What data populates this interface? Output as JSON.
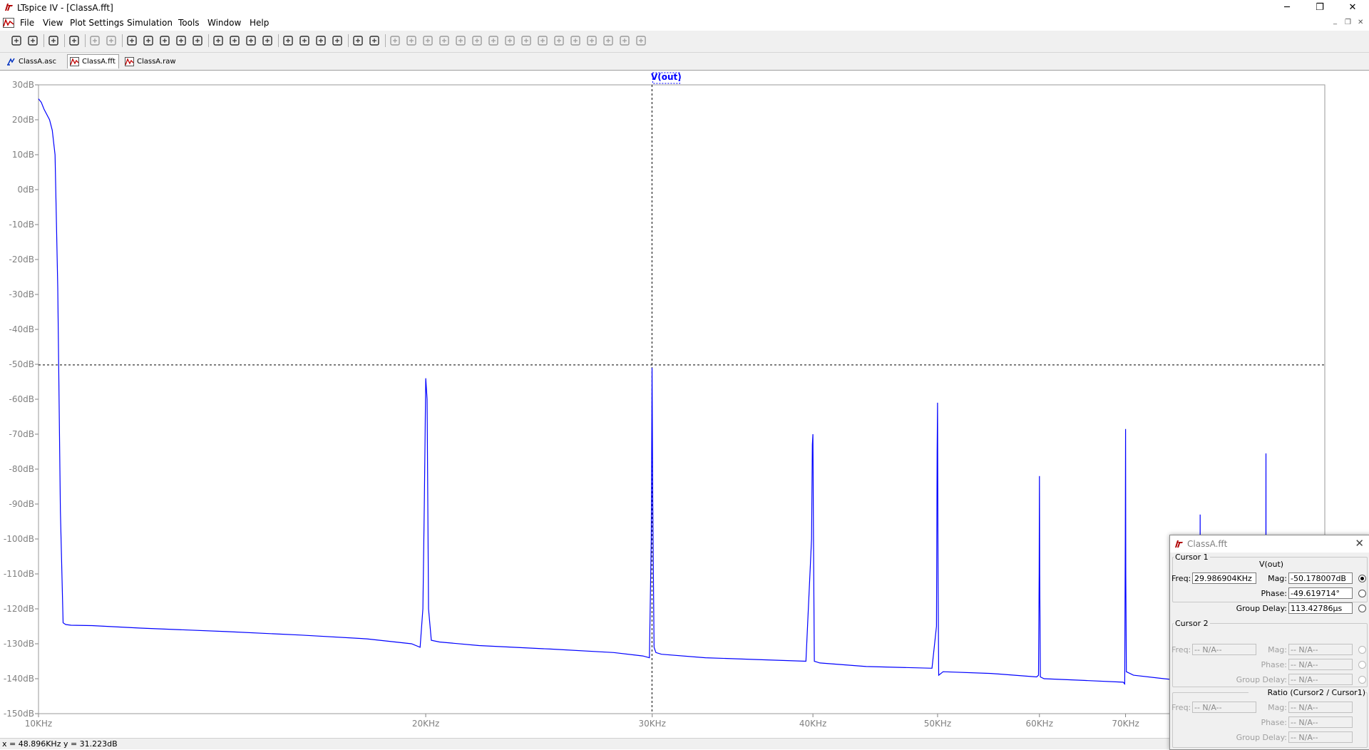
{
  "window": {
    "title": "LTspice IV - [ClassA.fft]",
    "minimize": "─",
    "restore": "❐",
    "close": "✕",
    "mdi_min": "_",
    "mdi_restore": "❐",
    "mdi_close": "✕"
  },
  "menu": {
    "items": [
      "File",
      "View",
      "Plot Settings",
      "Simulation",
      "Tools",
      "Window",
      "Help"
    ]
  },
  "toolbar": {
    "icons": [
      "new-schematic-icon",
      "open-icon",
      "save-icon",
      "control-panel-icon",
      "run-icon",
      "halt-icon",
      "zoom-in-icon",
      "zoom-out-icon",
      "zoom-back-icon",
      "zoom-fit-icon",
      "autoscale-icon",
      "delete-trace-icon",
      "tile-horizontal-icon",
      "tile-vertical-icon",
      "cascade-icon",
      "cut-icon",
      "copy-icon",
      "paste-icon",
      "find-icon",
      "print-preview-icon",
      "print-icon",
      "wire-icon",
      "ground-icon",
      "label-icon",
      "resistor-icon",
      "capacitor-icon",
      "inductor-icon",
      "diode-icon",
      "component-icon",
      "move-icon",
      "drag-icon",
      "undo-icon",
      "redo-icon",
      "rotate-icon",
      "mirror-icon",
      "text-icon",
      "spice-directive-icon"
    ]
  },
  "tabs": [
    {
      "label": "ClassA.asc",
      "icon": "schematic-icon",
      "active": false
    },
    {
      "label": "ClassA.fft",
      "icon": "waveform-icon",
      "active": true
    },
    {
      "label": "ClassA.raw",
      "icon": "waveform-icon",
      "active": false
    }
  ],
  "plot": {
    "trace_label": "V(out)",
    "trace_color": "#0000ff",
    "cursor": {
      "freq_khz": 29.986904,
      "mag_db": -50.178007
    }
  },
  "chart_data": {
    "type": "line",
    "title": "",
    "xlabel": "",
    "ylabel": "",
    "x_scale": "log",
    "xlim": [
      10,
      100
    ],
    "ylim": [
      -150,
      30
    ],
    "grid": false,
    "y_ticks": [
      30,
      20,
      10,
      0,
      -10,
      -20,
      -30,
      -40,
      -50,
      -60,
      -70,
      -80,
      -90,
      -100,
      -110,
      -120,
      -130,
      -140,
      -150
    ],
    "y_tick_labels": [
      "30dB",
      "20dB",
      "10dB",
      "0dB",
      "-10dB",
      "-20dB",
      "-30dB",
      "-40dB",
      "-50dB",
      "-60dB",
      "-70dB",
      "-80dB",
      "-90dB",
      "-100dB",
      "-110dB",
      "-120dB",
      "-130dB",
      "-140dB",
      "-150dB"
    ],
    "x_ticks": [
      10,
      20,
      30,
      40,
      50,
      60,
      70
    ],
    "x_tick_labels": [
      "10KHz",
      "20KHz",
      "30KHz",
      "40KHz",
      "50KHz",
      "60KHz",
      "70KHz"
    ],
    "series": [
      {
        "name": "V(out)",
        "x_khz": [
          10.0,
          10.05,
          10.1,
          10.2,
          10.25,
          10.3,
          10.35,
          10.4,
          10.45,
          10.5,
          10.6,
          11,
          12,
          14,
          16,
          18,
          19.5,
          19.8,
          19.9,
          19.95,
          20.0,
          20.05,
          20.1,
          20.2,
          20.5,
          22,
          25,
          28,
          29.5,
          29.85,
          29.95,
          29.99,
          30.03,
          30.1,
          30.2,
          30.5,
          33,
          36,
          39.5,
          39.9,
          39.96,
          40.0,
          40.04,
          40.1,
          40.5,
          44,
          49.5,
          49.9,
          49.96,
          50.0,
          50.04,
          50.1,
          50.5,
          55,
          59.7,
          59.9,
          59.97,
          60.0,
          60.03,
          60.1,
          60.5,
          65,
          69.7,
          69.9,
          69.97,
          70.0,
          70.03,
          70.1,
          71,
          75,
          79.9,
          79.98,
          80.0,
          80.02,
          80.1,
          85,
          89.9,
          89.98,
          90.0,
          90.02,
          90.1,
          95,
          100
        ],
        "y_db": [
          26,
          25,
          23,
          20,
          17,
          10,
          -28,
          -92,
          -124,
          -124.5,
          -124.7,
          -124.8,
          -125.5,
          -126.5,
          -127.5,
          -128.6,
          -130,
          -131,
          -120,
          -90,
          -54,
          -60,
          -120,
          -129,
          -129.5,
          -130.5,
          -131.5,
          -132.5,
          -133.5,
          -134,
          -100,
          -51,
          -90,
          -131,
          -132.5,
          -133,
          -134,
          -134.5,
          -135,
          -100,
          -73,
          -70,
          -100,
          -135,
          -135.5,
          -136.5,
          -137,
          -125,
          -75,
          -61,
          -110,
          -139,
          -138,
          -138.5,
          -139.5,
          -139,
          -110,
          -82,
          -110,
          -139.5,
          -140,
          -140.5,
          -141,
          -141.5,
          -100,
          -68.5,
          -110,
          -138,
          -139,
          -140,
          -141,
          -120,
          -93,
          -120,
          -141,
          -142,
          -142.5,
          -120,
          -75.5,
          -120,
          -142,
          -142.5,
          -143
        ]
      }
    ]
  },
  "status": {
    "readout": "x = 48.896KHz   y = 31.223dB"
  },
  "dialog": {
    "title": "ClassA.fft",
    "close": "✕",
    "cursor1": {
      "group_label": "Cursor 1",
      "trace": "V(out)",
      "freq_label": "Freq:",
      "freq_value": "29.986904KHz",
      "mag_label": "Mag:",
      "mag_value": "-50.178007dB",
      "phase_label": "Phase:",
      "phase_value": "-49.619714°",
      "gd_label": "Group Delay:",
      "gd_value": "113.42786µs"
    },
    "cursor2": {
      "group_label": "Cursor 2",
      "freq_label": "Freq:",
      "freq_value": "-- N/A--",
      "mag_label": "Mag:",
      "mag_value": "-- N/A--",
      "phase_label": "Phase:",
      "phase_value": "-- N/A--",
      "gd_label": "Group Delay:",
      "gd_value": "-- N/A--"
    },
    "ratio": {
      "group_label": "Ratio (Cursor2 / Cursor1)",
      "freq_label": "Freq:",
      "freq_value": "-- N/A--",
      "mag_label": "Mag:",
      "mag_value": "-- N/A--",
      "phase_label": "Phase:",
      "phase_value": "-- N/A--",
      "gd_label": "Group Delay:",
      "gd_value": "-- N/A--"
    }
  }
}
